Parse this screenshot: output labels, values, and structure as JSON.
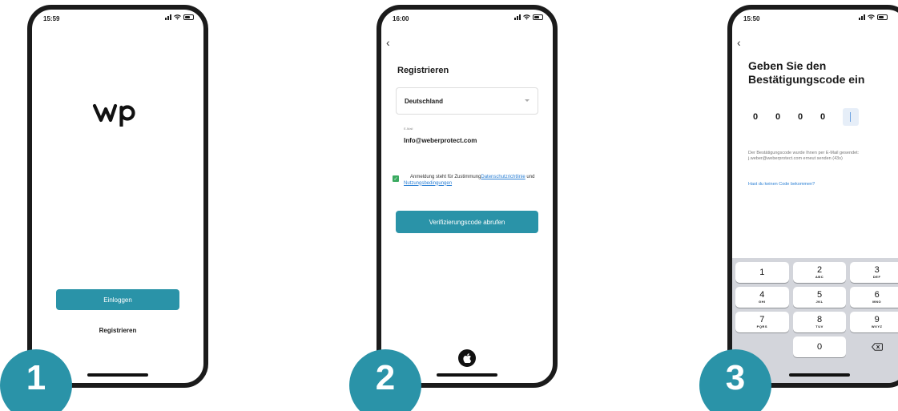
{
  "phones": [
    {
      "time": "15:59",
      "login_label": "Einloggen",
      "register_label": "Registrieren"
    },
    {
      "time": "16:00",
      "title": "Registrieren",
      "country": "Deutschland",
      "email_label": "E-Mail",
      "email_value": "Info@weberprotect.com",
      "consent_prefix": "Anmeldung steht für Zustimmung",
      "consent_privacy_link": "Datenschutzrichtlinie",
      "consent_and": " und ",
      "consent_terms_link": "Nutzungsbedingungen",
      "verify_label": "Verifizierungscode abrufen"
    },
    {
      "time": "15:50",
      "title_line1": "Geben Sie den",
      "title_line2": "Bestätigungscode ein",
      "code_digits": [
        "0",
        "0",
        "0",
        "0"
      ],
      "info_text": "Der Bestätigungscode wurde Ihnen per E-Mail gesendet: j.weber@weberprotect.com erneut senden (43s)",
      "no_code_link": "Hast du keinen Code bekommen?",
      "keypad": [
        [
          {
            "n": "1",
            "l": ""
          },
          {
            "n": "2",
            "l": "ABC"
          },
          {
            "n": "3",
            "l": "DEF"
          }
        ],
        [
          {
            "n": "4",
            "l": "GHI"
          },
          {
            "n": "5",
            "l": "JKL"
          },
          {
            "n": "6",
            "l": "MNO"
          }
        ],
        [
          {
            "n": "7",
            "l": "PQRS"
          },
          {
            "n": "8",
            "l": "TUV"
          },
          {
            "n": "9",
            "l": "WXYZ"
          }
        ],
        [
          {
            "n": "",
            "l": ""
          },
          {
            "n": "0",
            "l": ""
          },
          {
            "n": "",
            "l": ""
          }
        ]
      ]
    }
  ],
  "badges": [
    "1",
    "2",
    "3"
  ],
  "colors": {
    "accent": "#2a93a8",
    "link": "#2a7fd4",
    "checkbox": "#3aaa60"
  }
}
